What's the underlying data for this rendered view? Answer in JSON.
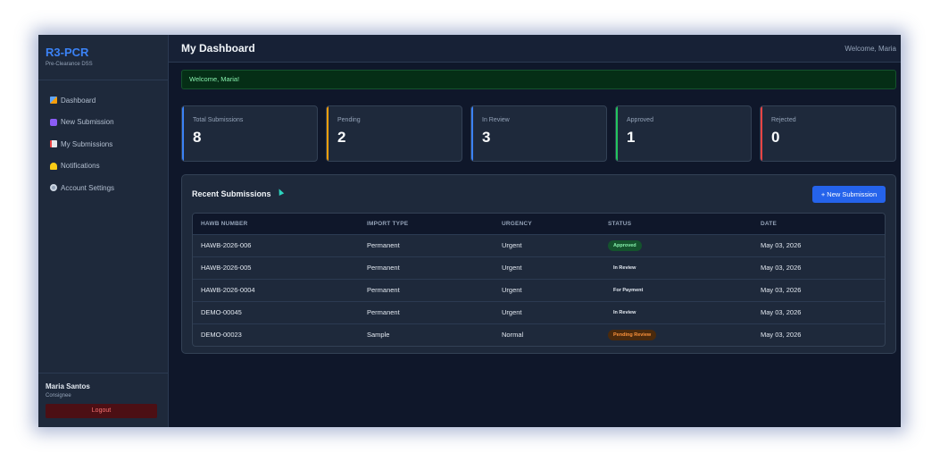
{
  "brand": {
    "title": "R3-PCR",
    "subtitle": "Pre-Clearance DSS"
  },
  "sidebar": {
    "items": [
      {
        "label": "Dashboard",
        "icon": "dashboard-icon"
      },
      {
        "label": "New Submission",
        "icon": "new-submission-icon"
      },
      {
        "label": "My Submissions",
        "icon": "submissions-icon"
      },
      {
        "label": "Notifications",
        "icon": "bell-icon"
      },
      {
        "label": "Account Settings",
        "icon": "gear-icon"
      }
    ],
    "user": {
      "name": "Maria Santos",
      "role": "Consignee"
    },
    "logout_label": "Logout"
  },
  "header": {
    "title": "My Dashboard",
    "welcome": "Welcome, Maria"
  },
  "alert": {
    "message": "Welcome, Maria!"
  },
  "stats": [
    {
      "label": "Total Submissions",
      "value": "8",
      "accent": "#3b82f6"
    },
    {
      "label": "Pending",
      "value": "2",
      "accent": "#f59e0b"
    },
    {
      "label": "In Review",
      "value": "3",
      "accent": "#3b82f6"
    },
    {
      "label": "Approved",
      "value": "1",
      "accent": "#22c55e"
    },
    {
      "label": "Rejected",
      "value": "0",
      "accent": "#ef4444"
    }
  ],
  "recent": {
    "title": "Recent Submissions",
    "new_button": "+ New Submission",
    "columns": [
      "HAWB NUMBER",
      "IMPORT TYPE",
      "URGENCY",
      "STATUS",
      "DATE"
    ],
    "rows": [
      {
        "hawb": "HAWB-2026-006",
        "type": "Permanent",
        "urgency": "Urgent",
        "status": "Approved",
        "date": "May 03, 2026"
      },
      {
        "hawb": "HAWB-2026-005",
        "type": "Permanent",
        "urgency": "Urgent",
        "status": "In Review",
        "date": "May 03, 2026"
      },
      {
        "hawb": "HAWB-2026-0004",
        "type": "Permanent",
        "urgency": "Urgent",
        "status": "For Payment",
        "date": "May 03, 2026"
      },
      {
        "hawb": "DEMO-00045",
        "type": "Permanent",
        "urgency": "Urgent",
        "status": "In Review",
        "date": "May 03, 2026"
      },
      {
        "hawb": "DEMO-00023",
        "type": "Sample",
        "urgency": "Normal",
        "status": "Pending Review",
        "date": "May 03, 2026"
      }
    ]
  },
  "colors": {
    "brand": "#3b82f6",
    "background": "#0f172a",
    "panel": "#1e293b",
    "primary_button": "#2563eb"
  }
}
